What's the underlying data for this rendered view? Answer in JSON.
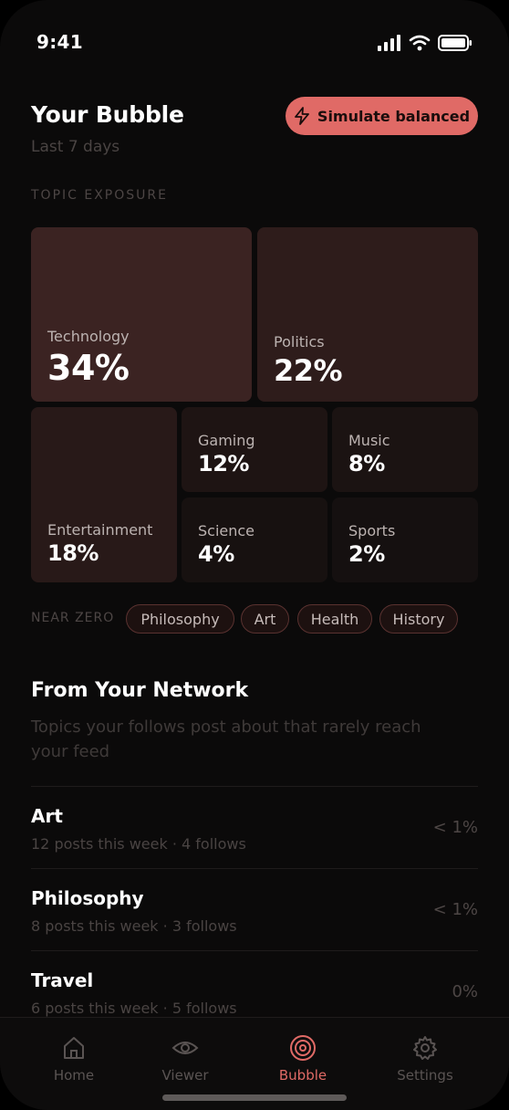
{
  "status_bar": {
    "time": "9:41"
  },
  "header": {
    "title": "Your Bubble",
    "subtitle": "Last 7 days",
    "simulate_label": "Simulate balanced"
  },
  "topic_exposure": {
    "label": "TOPIC EXPOSURE",
    "topics": [
      {
        "name": "Technology",
        "percent": "34%",
        "value": 34
      },
      {
        "name": "Politics",
        "percent": "22%",
        "value": 22
      },
      {
        "name": "Entertainment",
        "percent": "18%",
        "value": 18
      },
      {
        "name": "Gaming",
        "percent": "12%",
        "value": 12
      },
      {
        "name": "Music",
        "percent": "8%",
        "value": 8
      },
      {
        "name": "Science",
        "percent": "4%",
        "value": 4
      },
      {
        "name": "Sports",
        "percent": "2%",
        "value": 2
      }
    ]
  },
  "near_zero": {
    "label": "NEAR ZERO",
    "chips": [
      "Philosophy",
      "Art",
      "Health",
      "History"
    ]
  },
  "network": {
    "title": "From Your Network",
    "subtitle": "Topics your follows post about that rarely reach your feed",
    "items": [
      {
        "name": "Art",
        "meta": "12 posts this week · 4 follows",
        "value": "< 1%"
      },
      {
        "name": "Philosophy",
        "meta": "8 posts this week · 3 follows",
        "value": "< 1%"
      },
      {
        "name": "Travel",
        "meta": "6 posts this week · 5 follows",
        "value": "0%"
      }
    ]
  },
  "tab_bar": {
    "tabs": [
      {
        "label": "Home",
        "icon": "home-icon"
      },
      {
        "label": "Viewer",
        "icon": "eye-icon"
      },
      {
        "label": "Bubble",
        "icon": "target-icon",
        "active": true
      },
      {
        "label": "Settings",
        "icon": "gear-icon"
      }
    ]
  },
  "colors": {
    "accent": "#e06a66",
    "background": "#0b0a0a"
  }
}
